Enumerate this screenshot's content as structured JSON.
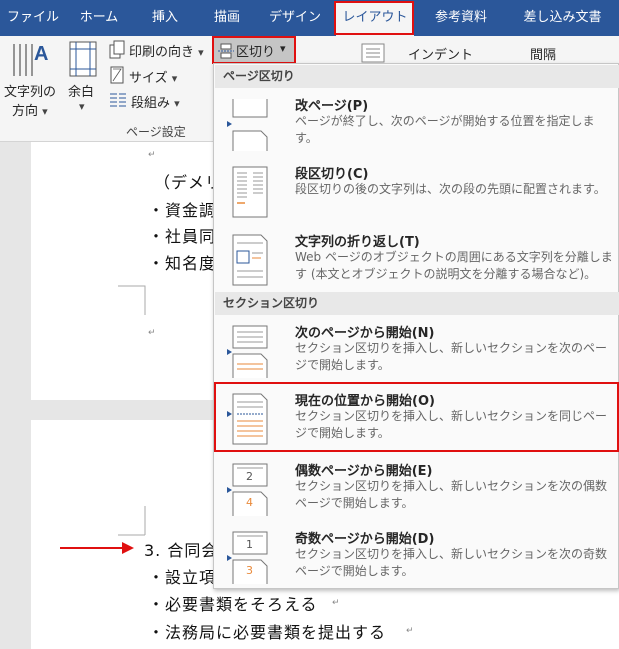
{
  "tabs": [
    {
      "label": "ファイル"
    },
    {
      "label": "ホーム"
    },
    {
      "label": "挿入"
    },
    {
      "label": "描画"
    },
    {
      "label": "デザイン"
    },
    {
      "label": "レイアウト",
      "active": true
    },
    {
      "label": "参考資料"
    },
    {
      "label": "差し込み文書"
    }
  ],
  "ribbon": {
    "text_direction_line1": "文字列の",
    "text_direction_line2": "方向",
    "margins": "余白",
    "orientation": "印刷の向き",
    "size": "サイズ",
    "columns": "段組み",
    "breaks": "区切り",
    "indent": "インデント",
    "spacing": "間隔",
    "group_label": "ページ設定"
  },
  "document": {
    "line1": "（デメリ",
    "line2": "・資金調",
    "line3": "・社員同",
    "line4": "・知名度",
    "line5": "3. 合同会",
    "line6": "・設立項",
    "line7": "・必要書類をそろえる",
    "line8": "・法務局に必要書類を提出する"
  },
  "menu": {
    "page_breaks_header": "ページ区切り",
    "section_breaks_header": "セクション区切り",
    "items": [
      {
        "title": "改ページ(P)",
        "desc": "ページが終了し、次のページが開始する位置を指定します。"
      },
      {
        "title": "段区切り(C)",
        "desc": "段区切りの後の文字列は、次の段の先頭に配置されます。"
      },
      {
        "title": "文字列の折り返し(T)",
        "desc": "Web ページのオブジェクトの周囲にある文字列を分離します (本文とオブジェクトの説明文を分離する場合など)。"
      },
      {
        "title": "次のページから開始(N)",
        "desc": "セクション区切りを挿入し、新しいセクションを次のページで開始します。"
      },
      {
        "title": "現在の位置から開始(O)",
        "desc": "セクション区切りを挿入し、新しいセクションを同じページで開始します。"
      },
      {
        "title": "偶数ページから開始(E)",
        "desc": "セクション区切りを挿入し、新しいセクションを次の偶数ページで開始します。"
      },
      {
        "title": "奇数ページから開始(D)",
        "desc": "セクション区切りを挿入し、新しいセクションを次の奇数ページで開始します。"
      }
    ],
    "icon_numbers": {
      "even_a": "2",
      "even_b": "4",
      "odd_a": "1",
      "odd_b": "3"
    }
  },
  "colors": {
    "ribbon_blue": "#2b579a",
    "highlight_red": "#e01010",
    "accent_orange": "#e98a3b"
  }
}
